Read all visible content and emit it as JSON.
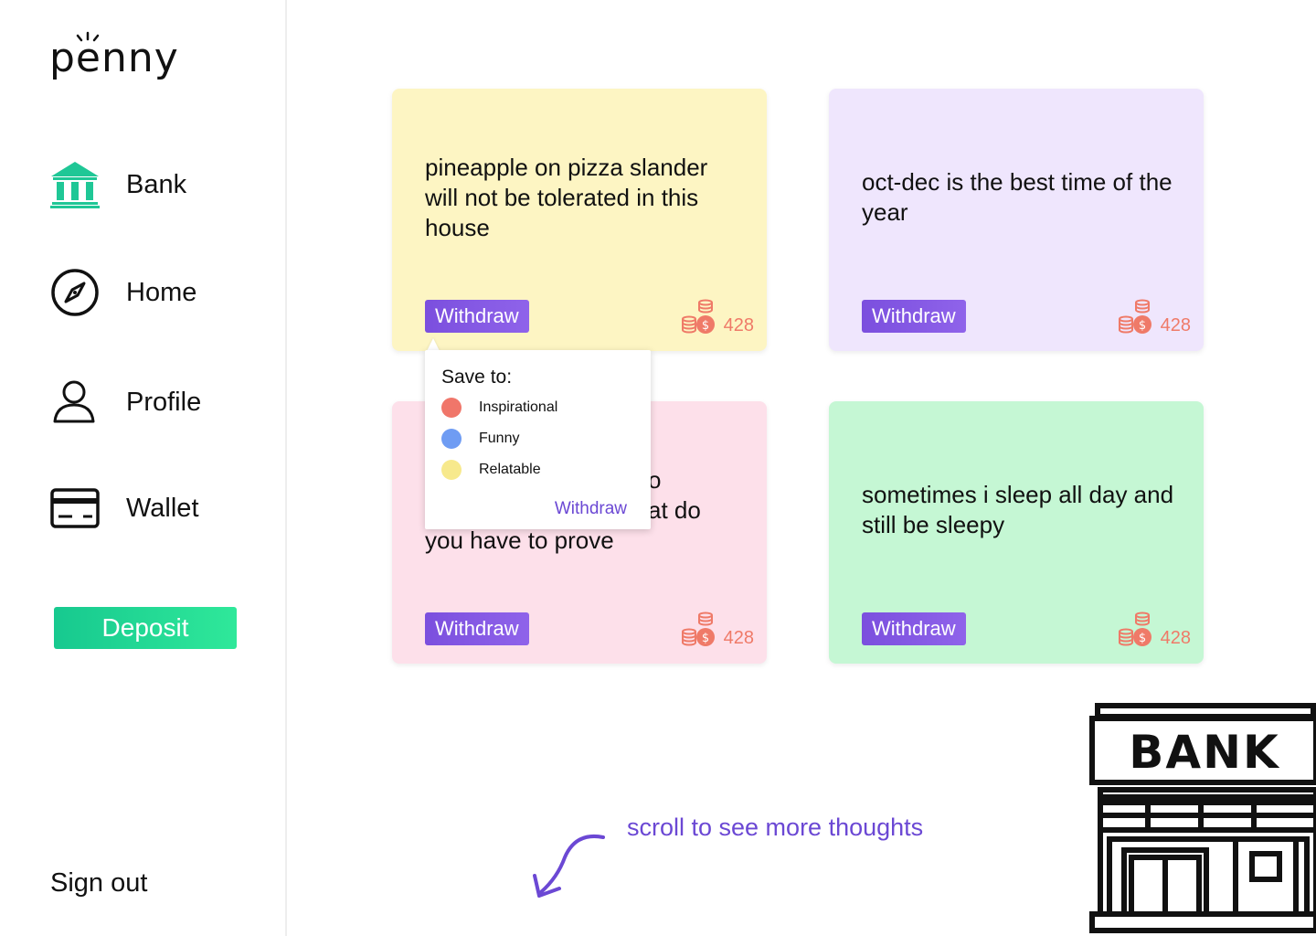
{
  "brand": {
    "name": "penny"
  },
  "nav": {
    "items": [
      {
        "label": "Bank",
        "icon": "bank-icon",
        "active": true
      },
      {
        "label": "Home",
        "icon": "compass-icon"
      },
      {
        "label": "Profile",
        "icon": "user-icon"
      },
      {
        "label": "Wallet",
        "icon": "credit-card-icon"
      }
    ],
    "deposit_label": "Deposit",
    "signout_label": "Sign out"
  },
  "cards": [
    {
      "text": "pineapple on pizza slander will not be tolerated in this house",
      "withdraw_label": "Withdraw",
      "coins": "428",
      "color": "#fdf5c3"
    },
    {
      "text": "oct-dec is the best time of the year",
      "withdraw_label": "Withdraw",
      "coins": "428",
      "color": "#efe6fd"
    },
    {
      "text": "you have to prove",
      "partial_lines": [
        "o",
        "at do"
      ],
      "withdraw_label": "Withdraw",
      "coins": "428",
      "color": "#fde0ea"
    },
    {
      "text": "sometimes i sleep all day and still be sleepy",
      "withdraw_label": "Withdraw",
      "coins": "428",
      "color": "#c5f7d4"
    }
  ],
  "popup": {
    "title": "Save to:",
    "options": [
      {
        "label": "Inspirational",
        "color": "#f0766a"
      },
      {
        "label": "Funny",
        "color": "#6f9cf3"
      },
      {
        "label": "Relatable",
        "color": "#f7e98c"
      }
    ],
    "withdraw_label": "Withdraw"
  },
  "scroll_hint": "scroll to see more thoughts",
  "bank_sign": "BANK",
  "colors": {
    "accent": "#6b48d4",
    "deposit": "#1fd693",
    "coins": "#ef7a68",
    "bank_icon": "#1fc796"
  }
}
